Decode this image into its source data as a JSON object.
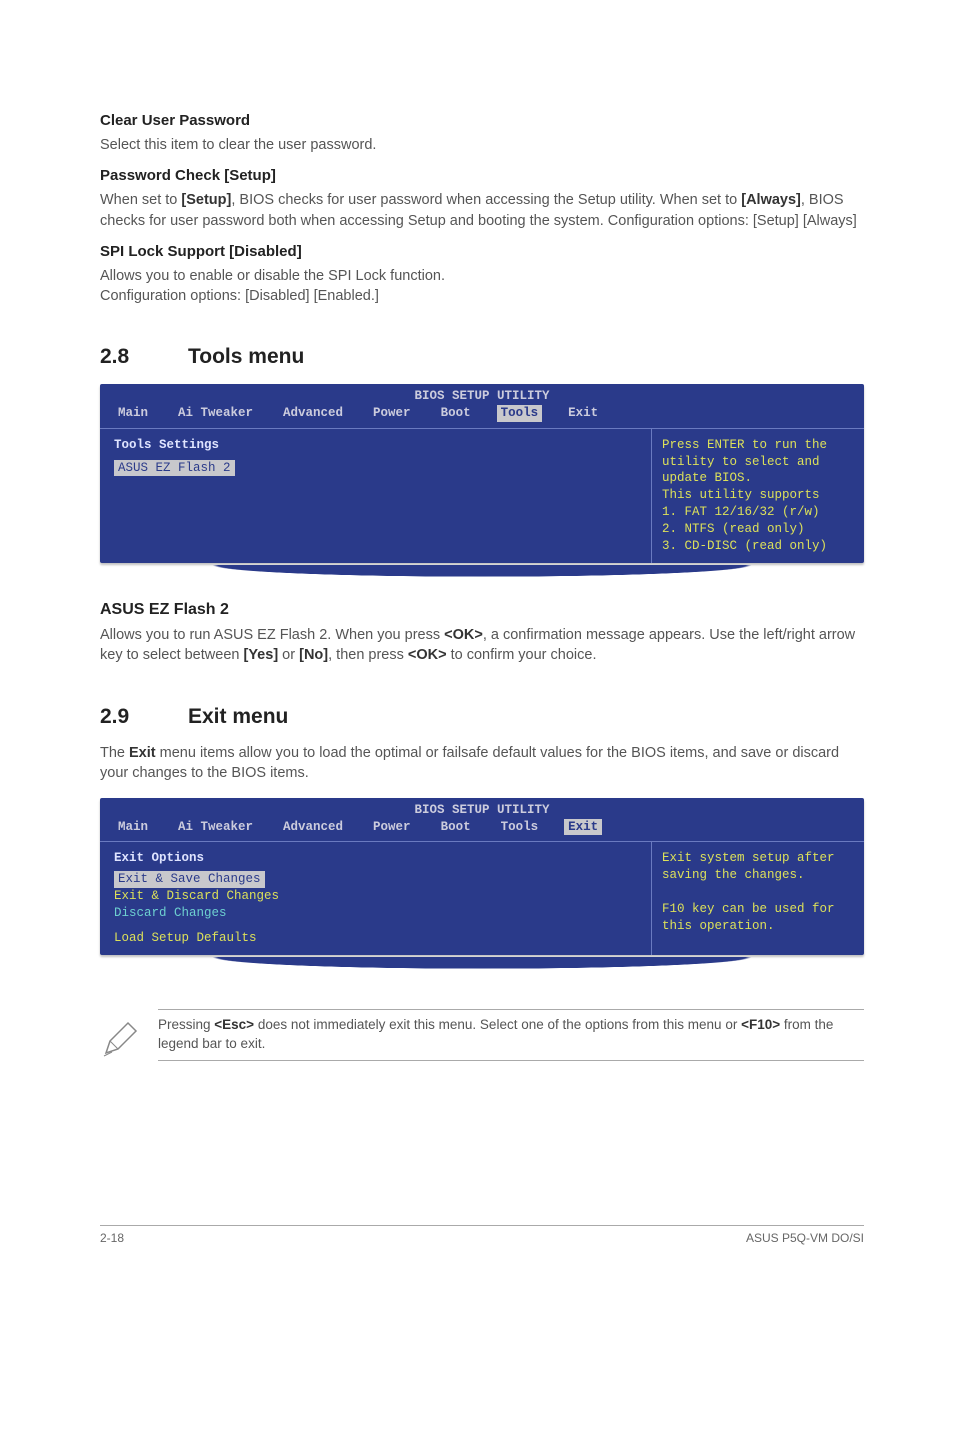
{
  "sections": {
    "clear_user": {
      "title": "Clear User Password",
      "body": "Select this item to clear the user password."
    },
    "pwd_check": {
      "title": "Password Check [Setup]",
      "pre": "When set to ",
      "b1": "[Setup]",
      "mid1": ", BIOS checks for user password when accessing the Setup utility. When set to ",
      "b2": "[Always]",
      "mid2": ", BIOS checks for user password both when accessing Setup and booting the system. Configuration options: [Setup] [Always]"
    },
    "spi": {
      "title": "SPI Lock Support [Disabled]",
      "l1": "Allows you to enable or disable the SPI Lock function.",
      "l2": "Configuration options: [Disabled] [Enabled.]"
    },
    "s28": {
      "num": "2.8",
      "title": "Tools menu"
    },
    "ezflash": {
      "title": "ASUS EZ Flash 2",
      "pre": "Allows you to run ASUS EZ Flash 2. When you press ",
      "b1": "<OK>",
      "mid1": ", a confirmation message appears. Use the left/right arrow key to select between ",
      "b2": "[Yes]",
      "mid2": " or ",
      "b3": "[No]",
      "mid3": ", then press ",
      "b4": "<OK>",
      "mid4": " to confirm your choice."
    },
    "s29": {
      "num": "2.9",
      "title": "Exit menu"
    },
    "exit_intro": {
      "pre": "The ",
      "b1": "Exit",
      "post": " menu items allow you to load the optimal or failsafe default values for the BIOS items, and save or discard your changes to the BIOS items."
    }
  },
  "bios_common": {
    "title": "BIOS SETUP UTILITY",
    "tabs": {
      "main": "Main",
      "ai": "Ai Tweaker",
      "adv": "Advanced",
      "power": "Power",
      "boot": "Boot",
      "tools": "Tools",
      "exit": "Exit"
    }
  },
  "bios_tools": {
    "left_heading": "Tools Settings",
    "left_item": "ASUS EZ Flash 2",
    "right": "Press ENTER to run the utility to select and update BIOS.\nThis utility supports\n1. FAT 12/16/32 (r/w)\n2. NTFS (read only)\n3. CD-DISC (read only)"
  },
  "bios_exit": {
    "left_heading": "Exit Options",
    "items": {
      "save": "Exit & Save Changes",
      "discard_exit": "Exit & Discard Changes",
      "discard": "Discard Changes",
      "load": "Load Setup Defaults"
    },
    "right": "Exit system setup after saving the changes.\n\nF10 key can be used for this operation."
  },
  "note": {
    "pre": "Pressing ",
    "b1": "<Esc>",
    "mid": " does not immediately exit this menu. Select one of the options from this menu or ",
    "b2": "<F10>",
    "post": " from the legend bar to exit."
  },
  "footer": {
    "left": "2-18",
    "right": "ASUS P5Q-VM DO/SI"
  }
}
